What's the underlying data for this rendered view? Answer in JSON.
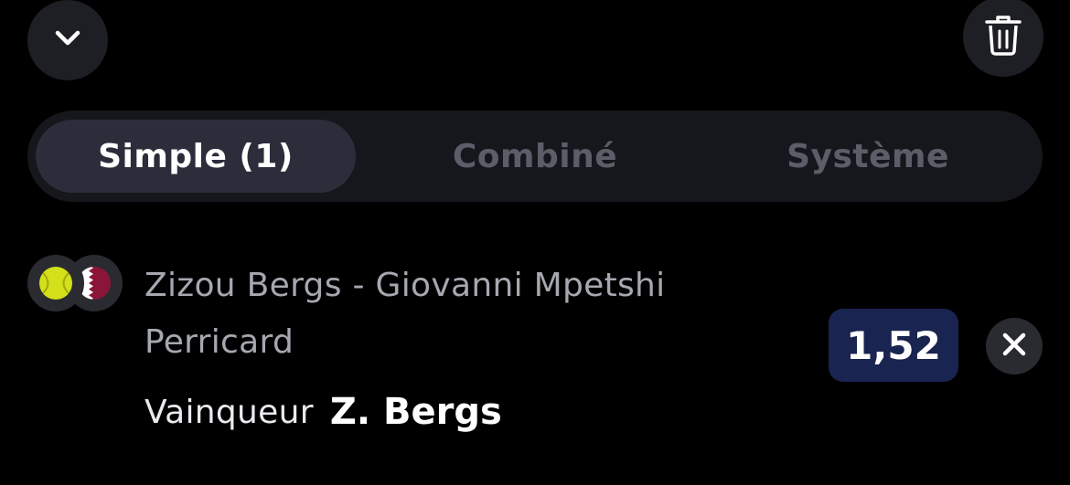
{
  "header": {
    "collapse_icon": "chevron-down-icon",
    "delete_icon": "trash-icon"
  },
  "tabs": [
    {
      "label": "Simple (1)",
      "active": true
    },
    {
      "label": "Combiné",
      "active": false
    },
    {
      "label": "Système",
      "active": false
    }
  ],
  "bet": {
    "sport_icon": "tennis-ball-icon",
    "country_icon": "qatar-flag-icon",
    "match": "Zizou Bergs - Giovanni Mpetshi Perricard",
    "market": "Vainqueur",
    "selection": "Z. Bergs",
    "odds": "1,52",
    "remove_icon": "close-icon"
  },
  "colors": {
    "background": "#000000",
    "active_tab": "#2b2d3b",
    "odds_badge": "#1a2450",
    "qatar_maroon": "#8a1538"
  }
}
